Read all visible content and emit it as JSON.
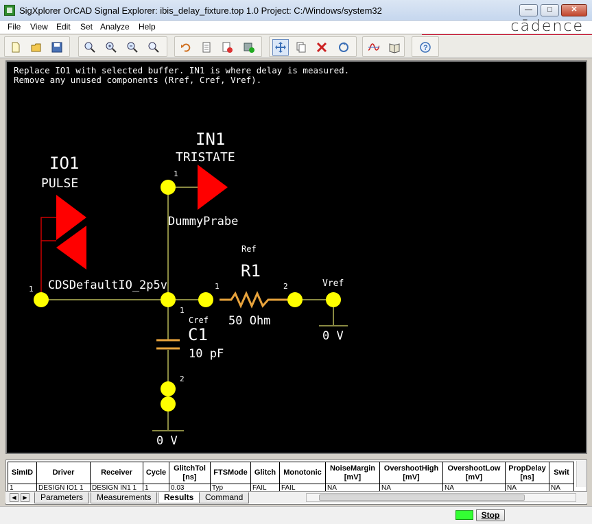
{
  "window": {
    "title": "SigXplorer OrCAD Signal Explorer: ibis_delay_fixture.top 1.0  Project: C:/Windows/system32",
    "brand": "cādence"
  },
  "menu": [
    "File",
    "View",
    "Edit",
    "Set",
    "Analyze",
    "Help"
  ],
  "toolbar": {
    "icons": [
      "new-icon",
      "open-icon",
      "save-icon",
      "zoom-fit-icon",
      "zoom-in-icon",
      "zoom-out-icon",
      "zoom-window-icon",
      "undo-icon",
      "copy-page-icon",
      "clear-icon",
      "add-part-icon",
      "move-icon",
      "copy-icon",
      "delete-icon",
      "rotate-icon",
      "waveform-icon",
      "library-icon",
      "help-icon"
    ]
  },
  "schematic": {
    "note_line1": "Replace IO1 with selected buffer. IN1 is where delay is measured.",
    "note_line2": "Remove any unused components (Rref, Cref, Vref).",
    "io1": {
      "name": "IO1",
      "type": "PULSE",
      "model": "CDSDefaultIO_2p5v",
      "pin": "1"
    },
    "in1": {
      "name": "IN1",
      "type": "TRISTATE",
      "model": "DummyPrabe",
      "pin": "1"
    },
    "r1": {
      "ref": "Ref",
      "name": "R1",
      "value": "50 Ohm",
      "pin1": "1",
      "pin2": "2"
    },
    "c1": {
      "ref": "Cref",
      "name": "C1",
      "value": "10 pF",
      "pin1": "1",
      "pin2": "2"
    },
    "vref": {
      "name": "Vref",
      "value": "0 V"
    },
    "ground": {
      "value": "0 V"
    },
    "colors": {
      "background": "#000000",
      "wire": "#8a8a42",
      "node": "#ffff00",
      "buffer": "#ff0000",
      "resistor": "#e8a33c",
      "text": "#ffffff"
    }
  },
  "results": {
    "columns": [
      "SimID",
      "Driver",
      "Receiver",
      "Cycle",
      "GlitchTol [ns]",
      "FTSMode",
      "Glitch",
      "Monotonic",
      "NoiseMargin [mV]",
      "OvershootHigh [mV]",
      "OvershootLow [mV]",
      "PropDelay [ns]",
      "Swit"
    ],
    "row": [
      "1",
      "DESIGN IO1 1",
      "DESIGN IN1 1",
      "1",
      "0.03",
      "Typ",
      "FAIL",
      "FAIL",
      "NA",
      "NA",
      "NA",
      "NA",
      "NA"
    ]
  },
  "tabs": [
    "Parameters",
    "Measurements",
    "Results",
    "Command"
  ],
  "active_tab": "Results",
  "status": {
    "stop_label": "Stop",
    "indicator_color": "#33ff33"
  }
}
